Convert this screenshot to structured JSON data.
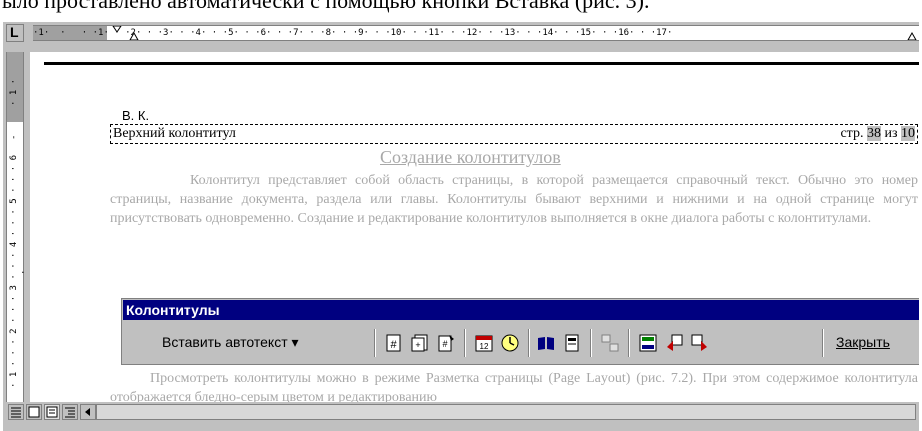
{
  "caption": {
    "text": "ыло проставлено автоматически с помощью кнопки Вставка (рис. 3)."
  },
  "header": {
    "author_label": "В. К.",
    "left_text": "Верхний колонтитул",
    "right_prefix": "стр. ",
    "page_num": "38",
    "of_text": " из ",
    "page_total": "10"
  },
  "document": {
    "title": "Создание колонтитулов",
    "para1": "Колонтитул представляет собой область страницы, в которой размещается справочный текст. Обычно это номер страницы, название документа, раздела или главы. Колонтитулы бывают верхними и нижними и на одной странице могут присутствовать одновременно. Создание и редактирование колонтитулов выполняется в окне диалога работы с колонтитулами.",
    "para2": "Просмотреть колонтитулы можно в режиме Разметка страницы (Page Layout) (рис. 7.2). При этом содержимое колонтитула отображается бледно-серым цветом и редактированию"
  },
  "ruler": {
    "horizontal": "·1·  ·   · ·1· · ·2· · ·3· · ·4· · ·5· · ·6· · ·7· · ·8· · ·9· · ·10· · ·11· · ·12· · ·13· · ·14· · ·15· · ·16· · ·17·",
    "vertical_top": "· 1 ·",
    "vertical_rest": "· 1 · · · 2 · · · 3 · · · 4 · · · 5 · · · 6 ·"
  },
  "toolbar": {
    "title": "Колонтитулы",
    "autotext_label": "Вставить автотекст ▾",
    "close_label": "Закрыть",
    "icons": [
      "insert-page-number-icon",
      "insert-page-count-icon",
      "format-page-number-icon",
      "insert-date-icon",
      "insert-time-icon",
      "page-setup-icon",
      "show-hide-text-icon",
      "same-as-previous-icon",
      "switch-header-footer-icon",
      "show-previous-icon",
      "show-next-icon"
    ]
  },
  "colors": {
    "titlebar": "#000080",
    "chrome": "#c0c0c0",
    "ghost_text": "#a8a8a8"
  }
}
